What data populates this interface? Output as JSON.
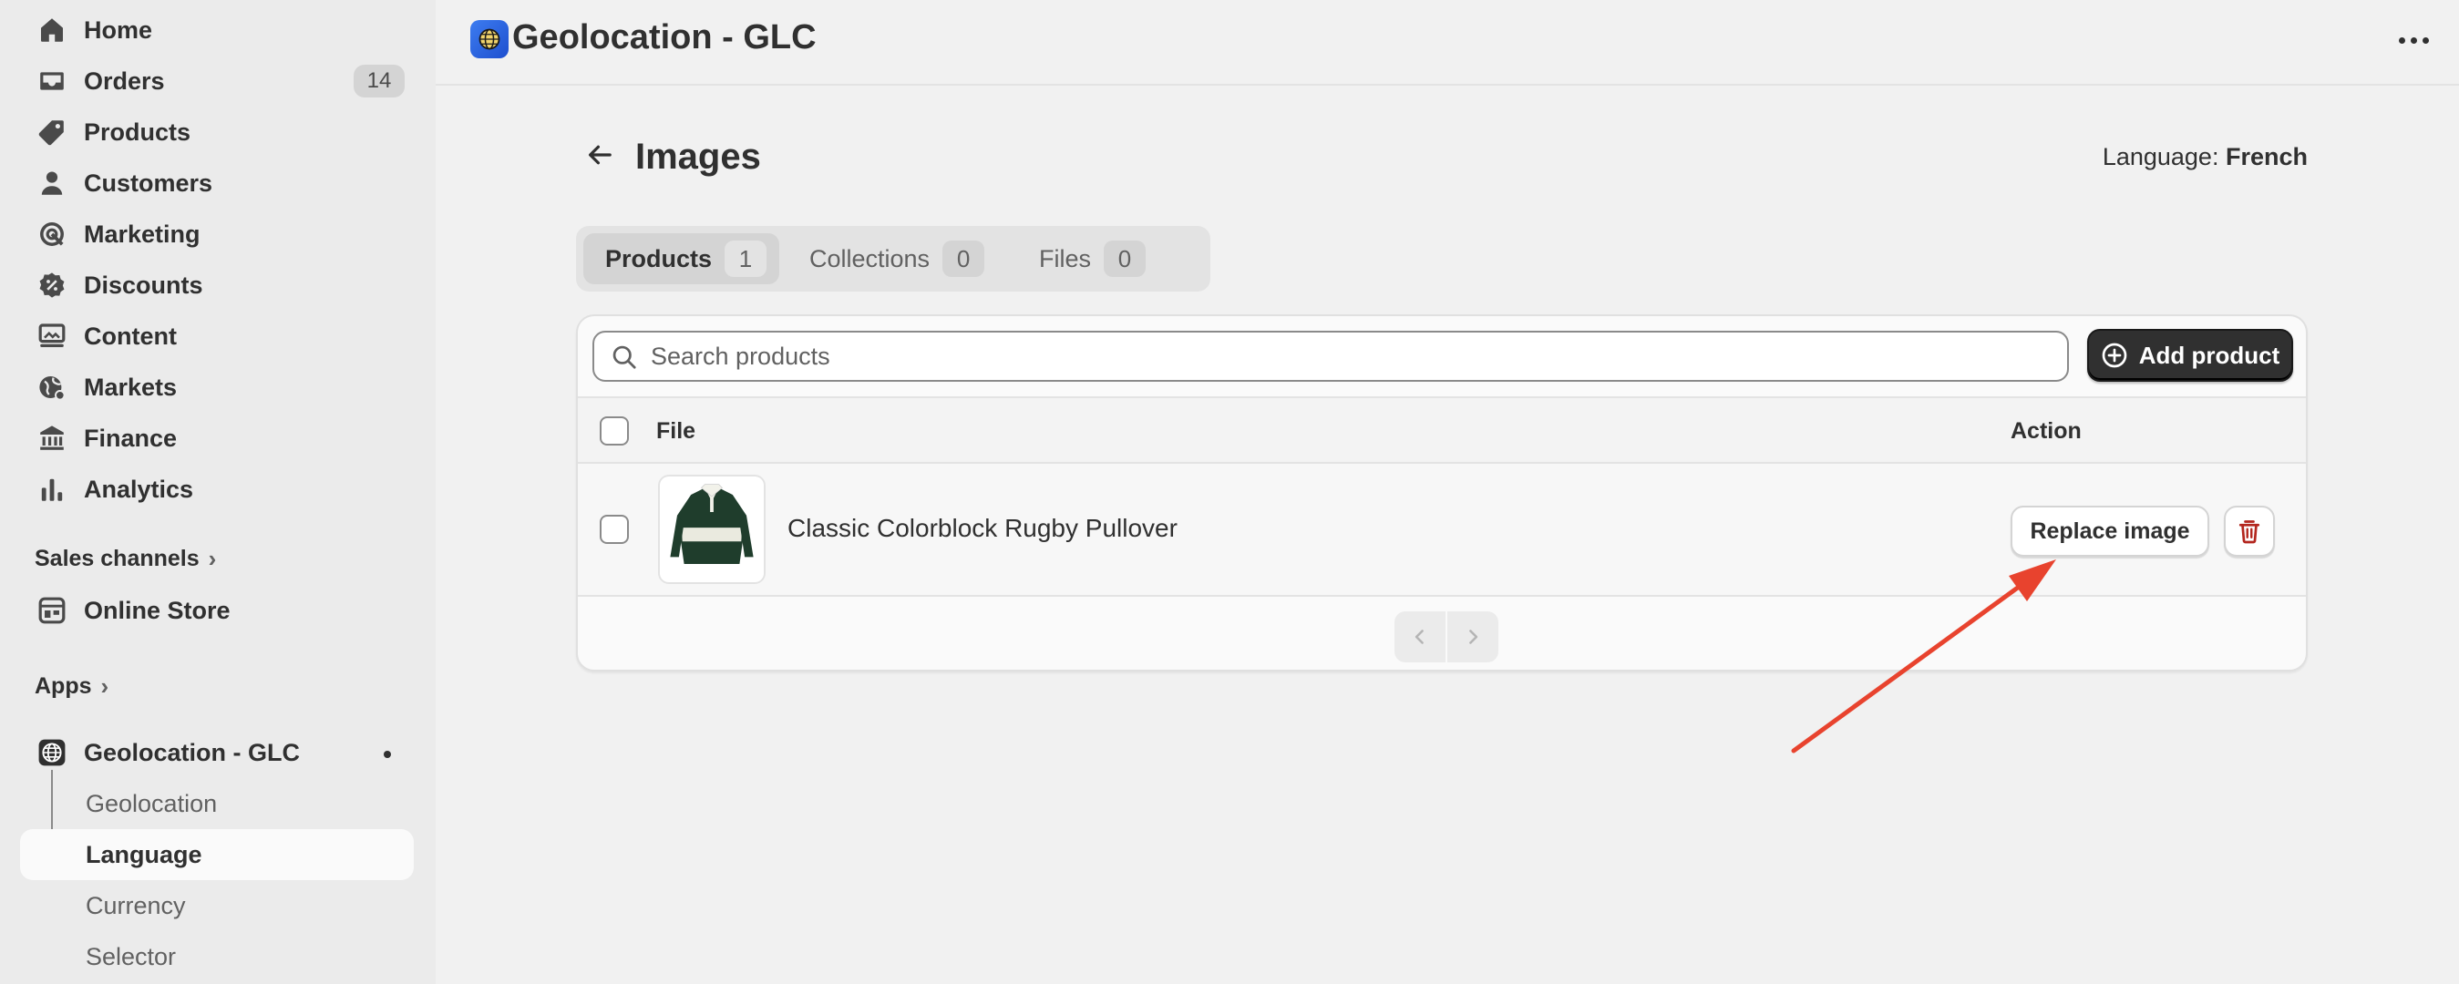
{
  "sidebar": {
    "nav": [
      {
        "label": "Home",
        "icon": "home-icon"
      },
      {
        "label": "Orders",
        "icon": "inbox-icon",
        "badge": "14"
      },
      {
        "label": "Products",
        "icon": "tag-icon"
      },
      {
        "label": "Customers",
        "icon": "person-icon"
      },
      {
        "label": "Marketing",
        "icon": "target-icon"
      },
      {
        "label": "Discounts",
        "icon": "discount-icon"
      },
      {
        "label": "Content",
        "icon": "content-icon"
      },
      {
        "label": "Markets",
        "icon": "globe-icon"
      },
      {
        "label": "Finance",
        "icon": "bank-icon"
      },
      {
        "label": "Analytics",
        "icon": "bar-chart-icon"
      }
    ],
    "sales_channels": {
      "label": "Sales channels",
      "chevron": "›"
    },
    "online_store": {
      "label": "Online Store",
      "icon": "store-icon"
    },
    "apps": {
      "label": "Apps",
      "chevron": "›"
    },
    "app": {
      "label": "Geolocation - GLC",
      "icon": "globe-app-icon"
    },
    "app_subitems": [
      {
        "label": "Geolocation",
        "active": false
      },
      {
        "label": "Language",
        "active": true
      },
      {
        "label": "Currency",
        "active": false
      },
      {
        "label": "Selector",
        "active": false
      }
    ]
  },
  "topbar": {
    "title": "Geolocation - GLC",
    "more_icon": "more-horizontal-icon"
  },
  "page": {
    "title": "Images",
    "language_prefix": "Language:",
    "language_value": "French"
  },
  "tabs": [
    {
      "label": "Products",
      "count": "1",
      "active": true
    },
    {
      "label": "Collections",
      "count": "0",
      "active": false
    },
    {
      "label": "Files",
      "count": "0",
      "active": false
    }
  ],
  "search": {
    "placeholder": "Search products"
  },
  "add_button": {
    "label": "Add product"
  },
  "table": {
    "headers": {
      "file": "File",
      "action": "Action"
    },
    "rows": [
      {
        "name": "Classic Colorblock Rugby Pullover",
        "action_label": "Replace image"
      }
    ]
  },
  "colors": {
    "annotation_arrow": "#e8432e",
    "delete_icon": "#b3261e",
    "primary_button": "#303030"
  }
}
